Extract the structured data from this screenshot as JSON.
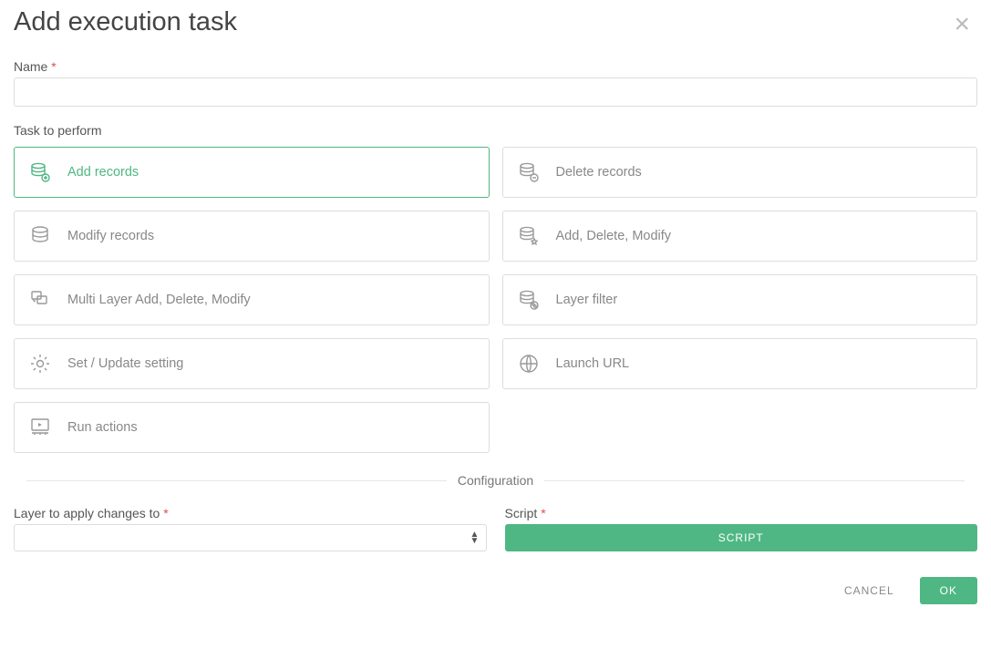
{
  "dialog": {
    "title": "Add execution task",
    "name_label": "Name",
    "task_label": "Task to perform",
    "configuration_label": "Configuration",
    "layer_label": "Layer to apply changes to",
    "script_label": "Script",
    "script_button": "SCRIPT",
    "cancel_button": "CANCEL",
    "ok_button": "OK",
    "required_marker": "*"
  },
  "tasks": {
    "t0": "Add records",
    "t1": "Delete records",
    "t2": "Modify records",
    "t3": "Add, Delete, Modify",
    "t4": "Multi Layer Add, Delete, Modify",
    "t5": "Layer filter",
    "t6": "Set / Update setting",
    "t7": "Launch URL",
    "t8": "Run actions"
  },
  "state": {
    "selected_task": "t0",
    "name_value": "",
    "layer_selected": ""
  }
}
